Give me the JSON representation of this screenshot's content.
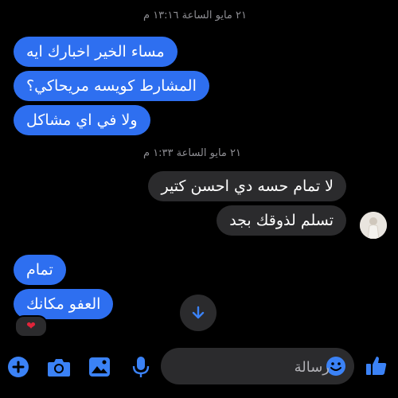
{
  "thread": {
    "timestamp_1": "٢١ مايو الساعة ١٣:١٦ م",
    "timestamp_2": "٢١ مايو الساعة ١:٣٣ م",
    "messages_out_1": [
      "مساء الخير اخبارك ايه",
      "المشارط كويسه مريحاكي؟",
      "ولا في اي مشاكل"
    ],
    "messages_in": [
      "لا تمام حسه دي احسن كتير",
      "تسلم لذوقك بجد"
    ],
    "messages_out_2": [
      "تمام",
      "العفو مكانك"
    ],
    "reaction_emoji": "❤"
  },
  "composer": {
    "placeholder": "رسالة"
  },
  "colors": {
    "outgoing_bubble": "#2e6ff0",
    "incoming_bubble": "#2b2b2d",
    "accent": "#3b82f6"
  }
}
